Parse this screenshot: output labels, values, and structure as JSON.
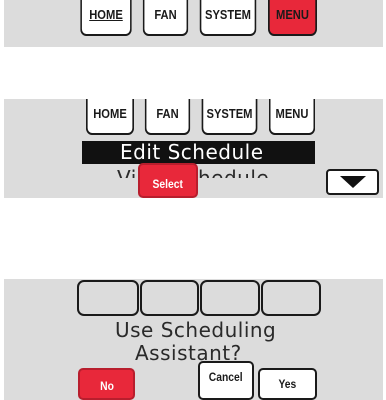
{
  "screen1": {
    "tabs": [
      {
        "label": "HOME",
        "active": false
      },
      {
        "label": "FAN",
        "active": false
      },
      {
        "label": "SYSTEM",
        "active": false
      },
      {
        "label": "MENU",
        "active": true
      }
    ]
  },
  "screen2": {
    "tabs": [
      {
        "label": "HOME"
      },
      {
        "label": "FAN"
      },
      {
        "label": "SYSTEM"
      },
      {
        "label": "MENU"
      }
    ],
    "menu_items": [
      {
        "label": "Edit Schedule",
        "selected": true
      },
      {
        "label": "View Schedule",
        "selected": false
      }
    ],
    "select_label": "Select",
    "scroll_icon": "down-arrow-icon"
  },
  "screen3": {
    "prompt_line1": "Use Scheduling",
    "prompt_line2": "Assistant?",
    "no_label": "No",
    "cancel_label": "Cancel",
    "yes_label": "Yes"
  },
  "colors": {
    "accent_red": "#e8283a",
    "panel_gray": "#dcdcdc",
    "ink": "#1a1a1a"
  }
}
